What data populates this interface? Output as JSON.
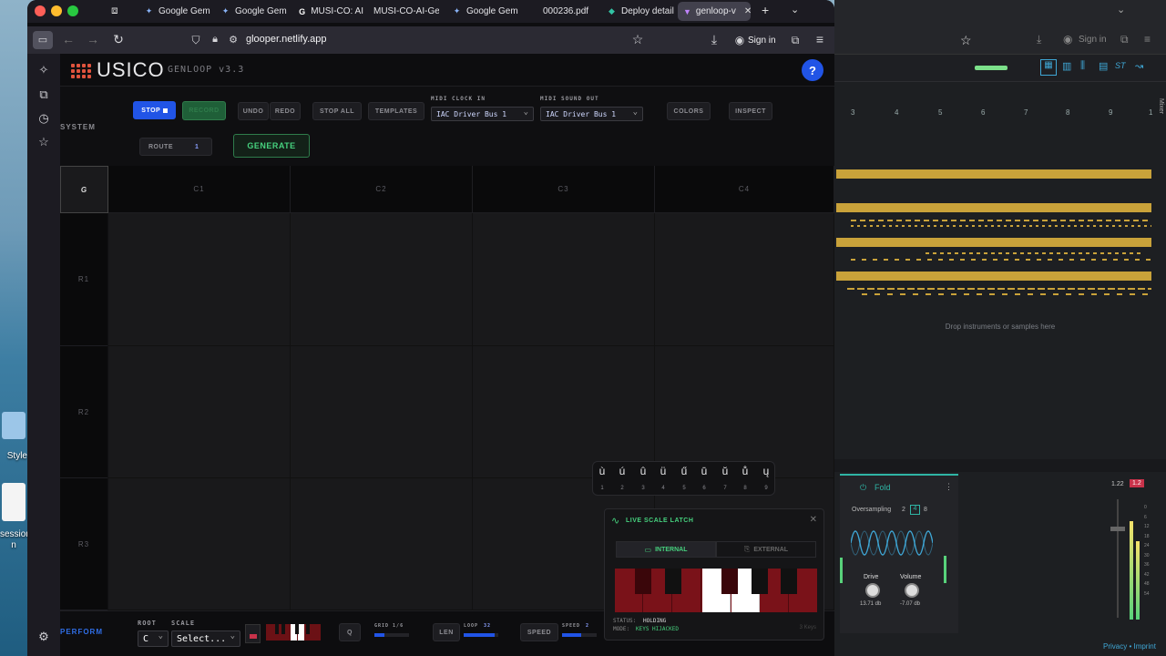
{
  "desktop": {
    "labels": [
      "Style",
      "session",
      "n"
    ]
  },
  "browser": {
    "tabs": [
      {
        "label": "Google Gem",
        "icon": "gemini-icon"
      },
      {
        "label": "Google Gem",
        "icon": "gemini-icon"
      },
      {
        "label": "MUSI-CO: AI",
        "icon": "google-icon"
      },
      {
        "label": "MUSI-CO-AI-Gen",
        "icon": ""
      },
      {
        "label": "Google Gem",
        "icon": "gemini-icon"
      },
      {
        "label": "000236.pdf",
        "icon": ""
      },
      {
        "label": "Deploy detail",
        "icon": "netlify-icon"
      },
      {
        "label": "genloop-v",
        "icon": "app-icon"
      }
    ],
    "url": "glooper.netlify.app",
    "sign_in": "Sign in"
  },
  "app": {
    "logo": "USICO",
    "version": "GENLOOP v3.3",
    "help": "?",
    "system_label": "SYSTEM",
    "buttons": {
      "stop": "STOP",
      "record": "RECORD",
      "undo": "UNDO",
      "redo": "REDO",
      "stop_all": "STOP ALL",
      "templates": "TEMPLATES",
      "colors": "COLORS",
      "inspect": "INSPECT",
      "route": "ROUTE",
      "route_value": "1",
      "generate": "GENERATE"
    },
    "midi_clock_in": {
      "label": "MIDI CLOCK IN",
      "value": "IAC Driver Bus 1"
    },
    "midi_sound_out": {
      "label": "MIDI SOUND OUT",
      "value": "IAC Driver Bus 1"
    },
    "grid": {
      "corner": "G",
      "columns": [
        "C1",
        "C2",
        "C3",
        "C4"
      ],
      "rows": [
        "R1",
        "R2",
        "R3"
      ]
    },
    "bottom": {
      "perform": "PERFORM",
      "root_label": "ROOT",
      "root_value": "C",
      "scale_label": "SCALE",
      "scale_value": "Select...",
      "q": "Q",
      "grid_label": "GRID 1/6",
      "len": "LEN",
      "loop_label": "LOOP",
      "loop_value": "32",
      "speed": "SPEED",
      "speed_label": "SPEED",
      "speed_value": "2"
    },
    "key_row": {
      "keys": [
        "ù",
        "ú",
        "û",
        "ü",
        "ű",
        "ū",
        "ŭ",
        "ů",
        "ų"
      ],
      "nums": [
        "1",
        "2",
        "3",
        "4",
        "5",
        "6",
        "7",
        "8",
        "9"
      ]
    },
    "latch": {
      "title": "LIVE SCALE LATCH",
      "internal": "INTERNAL",
      "external": "EXTERNAL",
      "status_label": "STATUS:",
      "status_value": "HOLDING",
      "mode_label": "MODE:",
      "mode_value": "KEYS HIJACKED",
      "keys_count": "3 Keys"
    }
  },
  "daw": {
    "ruler": [
      "3",
      "4",
      "5",
      "6",
      "7",
      "8",
      "9",
      "1"
    ],
    "drop_text": "Drop instruments or samples here",
    "sign_in": "Sign in",
    "plugin": {
      "name": "Fold",
      "oversampling_label": "Oversampling",
      "oversampling_options": [
        "2",
        "4",
        "8"
      ],
      "drive_label": "Drive",
      "drive_value": "13.71 db",
      "volume_label": "Volume",
      "volume_value": "-7.07 db"
    },
    "meter_values": [
      "1.22",
      "1.2"
    ],
    "scale": [
      "0",
      "6",
      "12",
      "18",
      "24",
      "30",
      "36",
      "42",
      "48",
      "54"
    ],
    "footer": "Privacy • Imprint",
    "mixer_label": "Mixer"
  }
}
